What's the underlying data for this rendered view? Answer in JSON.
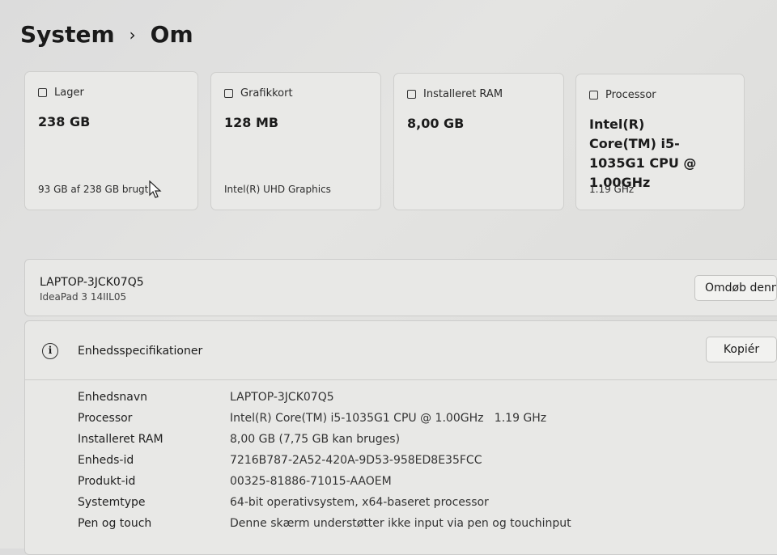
{
  "breadcrumb": {
    "parent": "System",
    "separator": "›",
    "current": "Om"
  },
  "cards": [
    {
      "label": "Lager",
      "value": "238 GB",
      "sub": "93 GB af 238 GB brugt",
      "icon": "storage-icon"
    },
    {
      "label": "Grafikkort",
      "value": "128 MB",
      "sub": "Intel(R) UHD Graphics",
      "icon": "graphics-card-icon"
    },
    {
      "label": "Installeret RAM",
      "value": "8,00 GB",
      "sub": "",
      "icon": "ram-icon"
    },
    {
      "label": "Processor",
      "value": "Intel(R) Core(TM) i5-1035G1 CPU @ 1.00GHz",
      "sub": "1.19 GHz",
      "icon": "processor-icon"
    }
  ],
  "device": {
    "name": "LAPTOP-3JCK07Q5",
    "model": "IdeaPad 3 14IIL05",
    "rename_label": "Omdøb denne"
  },
  "specs": {
    "title": "Enhedsspecifikationer",
    "copy_label": "Kopiér",
    "rows": [
      {
        "key": "Enhedsnavn",
        "value": "LAPTOP-3JCK07Q5"
      },
      {
        "key": "Processor",
        "value": "Intel(R) Core(TM) i5-1035G1 CPU @ 1.00GHz   1.19 GHz"
      },
      {
        "key": "Installeret RAM",
        "value": "8,00 GB (7,75 GB kan bruges)"
      },
      {
        "key": "Enheds-id",
        "value": "7216B787-2A52-420A-9D53-958ED8E35FCC"
      },
      {
        "key": "Produkt-id",
        "value": "00325-81886-71015-AAOEM"
      },
      {
        "key": "Systemtype",
        "value": "64-bit operativsystem, x64-baseret processor"
      },
      {
        "key": "Pen og touch",
        "value": "Denne skærm understøtter ikke input via pen og touchinput"
      }
    ]
  }
}
